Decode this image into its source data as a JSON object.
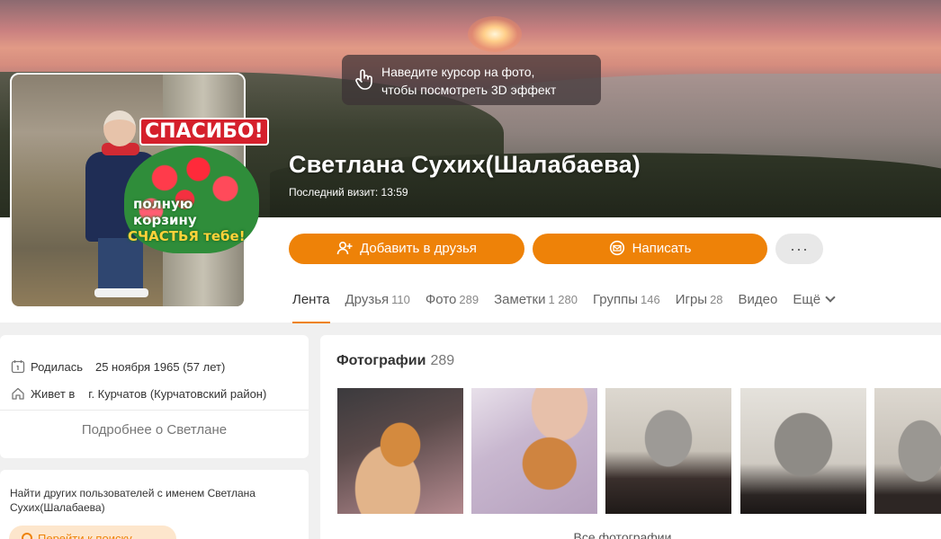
{
  "hint": {
    "line1": "Наведите курсор на фото,",
    "line2": "чтобы посмотреть 3D эффект"
  },
  "profile": {
    "name": "Светлана Сухих(Шалабаева)",
    "last_visit": "Последний визит: 13:59",
    "avatar_text": {
      "thanks": "СПАСИБО!",
      "line1": "полную",
      "line2": "корзину",
      "line3": "СЧАСТЬЯ тебе!"
    }
  },
  "actions": {
    "add_friend": "Добавить в друзья",
    "write": "Написать",
    "more": "···"
  },
  "tabs": [
    {
      "label": "Лента",
      "count": ""
    },
    {
      "label": "Друзья",
      "count": "110"
    },
    {
      "label": "Фото",
      "count": "289"
    },
    {
      "label": "Заметки",
      "count": "1 280"
    },
    {
      "label": "Группы",
      "count": "146"
    },
    {
      "label": "Игры",
      "count": "28"
    },
    {
      "label": "Видео",
      "count": ""
    },
    {
      "label": "Ещё",
      "count": ""
    }
  ],
  "info": {
    "born_label": "Родилась",
    "born_value": "25 ноября 1965 (57 лет)",
    "lives_label": "Живет в",
    "lives_value": "г. Курчатов (Курчатовский район)",
    "more_link": "Подробнее о Светлане"
  },
  "find": {
    "text": "Найти других пользователей с именем Светлана Сухих(Шалабаева)",
    "button": "Перейти к поиску"
  },
  "photos": {
    "title": "Фотографии",
    "count": "289",
    "all_link": "Все фотографии"
  },
  "colors": {
    "accent": "#ee8208",
    "more_button_bg": "#e8e8e8"
  },
  "icons": [
    "hand-pointer-icon",
    "add-friend-icon",
    "mail-icon",
    "calendar-icon",
    "home-icon",
    "chevron-down-icon",
    "search-icon"
  ]
}
